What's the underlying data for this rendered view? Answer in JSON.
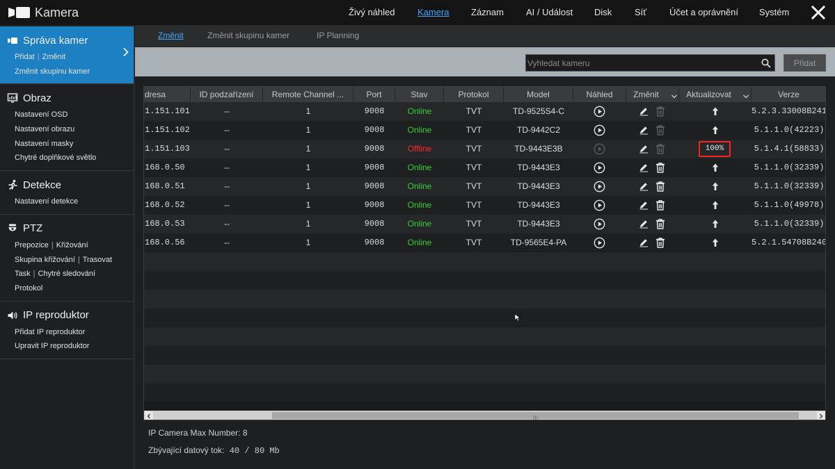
{
  "app": {
    "title": "Kamera"
  },
  "topnav": [
    "Živý náhled",
    "Kamera",
    "Záznam",
    "AI / Událost",
    "Disk",
    "Síť",
    "Účet a oprávnění",
    "Systém"
  ],
  "topnav_active": "Kamera",
  "sidebar": {
    "groups": [
      {
        "title": "Správa kamer",
        "icon": "camera-icon",
        "active": true,
        "lines": [
          [
            "Přidat",
            "Změnit"
          ],
          [
            "Změnit skupinu kamer"
          ]
        ]
      },
      {
        "title": "Obraz",
        "icon": "image-settings-icon",
        "active": false,
        "lines": [
          [
            "Nastavení OSD"
          ],
          [
            "Nastavení obrazu"
          ],
          [
            "Nastavení masky"
          ],
          [
            "Chytré doplňkové světlo"
          ]
        ]
      },
      {
        "title": "Detekce",
        "icon": "running-person-icon",
        "active": false,
        "lines": [
          [
            "Nastavení detekce"
          ]
        ]
      },
      {
        "title": "PTZ",
        "icon": "ptz-camera-icon",
        "active": false,
        "lines": [
          [
            "Prepozice",
            "Křižování"
          ],
          [
            "Skupina křižování",
            "Trasovat"
          ],
          [
            "Task",
            "Chytré sledování"
          ],
          [
            "Protokol"
          ]
        ]
      },
      {
        "title": "IP reproduktor",
        "icon": "speaker-icon",
        "active": false,
        "lines": [
          [
            "Přidat IP reproduktor"
          ],
          [
            "Upravit IP reproduktor"
          ]
        ]
      }
    ]
  },
  "subtabs": [
    "Změnit",
    "Změnit skupinu kamer",
    "IP Planning"
  ],
  "subtab_active": "Změnit",
  "search": {
    "placeholder": "Vyhledat kameru",
    "value": ""
  },
  "add_button": "Přidat",
  "table": {
    "columns": [
      "dresa",
      "ID podzařízení",
      "Remote Channel ...",
      "Port",
      "Stav",
      "Protokol",
      "Model",
      "Náhled",
      "Změnit",
      "Aktualizovat",
      "Verze"
    ],
    "rows": [
      {
        "address": "1.151.101",
        "sub_id": "--",
        "channel": "1",
        "port": "9008",
        "status": "Online",
        "protocol": "TVT",
        "model": "TD-9525S4-C",
        "update": "arrow",
        "version": "5.2.3.33008B241..."
      },
      {
        "address": "1.151.102",
        "sub_id": "--",
        "channel": "1",
        "port": "9008",
        "status": "Online",
        "protocol": "TVT",
        "model": "TD-9442C2",
        "update": "arrow",
        "version": "5.1.1.0(42223)"
      },
      {
        "address": "1.151.103",
        "sub_id": "--",
        "channel": "1",
        "port": "9008",
        "status": "Offline",
        "protocol": "TVT",
        "model": "TD-9443E3B",
        "update": "100%",
        "version": "5.1.4.1(58833)"
      },
      {
        "address": "168.0.50",
        "sub_id": "--",
        "channel": "1",
        "port": "9008",
        "status": "Online",
        "protocol": "TVT",
        "model": "TD-9443E3",
        "update": "arrow",
        "version": "5.1.1.0(32339)"
      },
      {
        "address": "168.0.51",
        "sub_id": "--",
        "channel": "1",
        "port": "9008",
        "status": "Online",
        "protocol": "TVT",
        "model": "TD-9443E3",
        "update": "arrow",
        "version": "5.1.1.0(32339)"
      },
      {
        "address": "168.0.52",
        "sub_id": "--",
        "channel": "1",
        "port": "9008",
        "status": "Online",
        "protocol": "TVT",
        "model": "TD-9443E3",
        "update": "arrow",
        "version": "5.1.1.0(49978)"
      },
      {
        "address": "168.0.53",
        "sub_id": "--",
        "channel": "1",
        "port": "9008",
        "status": "Online",
        "protocol": "TVT",
        "model": "TD-9443E3",
        "update": "arrow",
        "version": "5.1.1.0(32339)"
      },
      {
        "address": "168.0.56",
        "sub_id": "--",
        "channel": "1",
        "port": "9008",
        "status": "Online",
        "protocol": "TVT",
        "model": "TD-9565E4-PA",
        "update": "arrow",
        "version": "5.2.1.54708B240..."
      }
    ]
  },
  "footer": {
    "max_label": "IP Camera Max Number: 8",
    "bitrate_label": "Zbývající datový tok:",
    "bitrate_value": "40 / 80 Mb"
  },
  "colors": {
    "accent": "#1d80c2",
    "link": "#3fa7ff",
    "online": "#35d035",
    "offline": "#ff2a2a",
    "highlight_box": "#ff2020"
  }
}
